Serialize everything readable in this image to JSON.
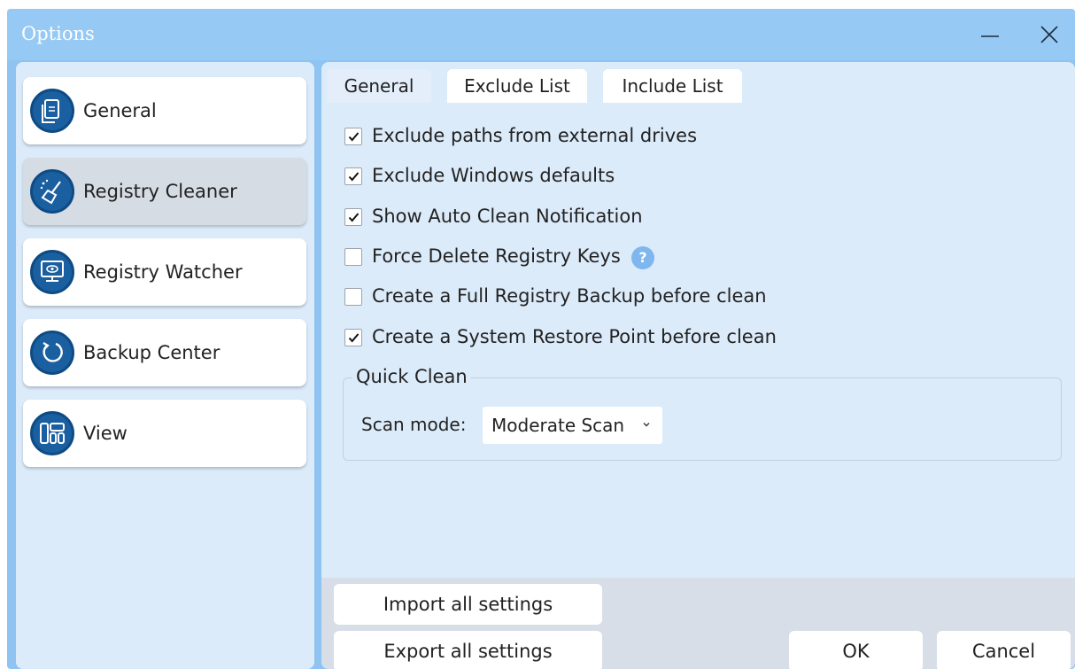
{
  "window": {
    "title": "Options"
  },
  "sidebar": {
    "items": [
      {
        "label": "General",
        "icon": "document-icon",
        "active": false
      },
      {
        "label": "Registry Cleaner",
        "icon": "broom-icon",
        "active": true
      },
      {
        "label": "Registry Watcher",
        "icon": "monitor-eye-icon",
        "active": false
      },
      {
        "label": "Backup Center",
        "icon": "restore-icon",
        "active": false
      },
      {
        "label": "View",
        "icon": "layout-icon",
        "active": false
      }
    ]
  },
  "tabs": [
    {
      "label": "General",
      "active": true
    },
    {
      "label": "Exclude List",
      "active": false
    },
    {
      "label": "Include List",
      "active": false
    }
  ],
  "options": [
    {
      "label": "Exclude paths from external drives",
      "checked": true
    },
    {
      "label": "Exclude Windows defaults",
      "checked": true
    },
    {
      "label": "Show Auto Clean Notification",
      "checked": true
    },
    {
      "label": "Force Delete Registry Keys",
      "checked": false,
      "help_icon": "question-icon",
      "help_text": "?"
    },
    {
      "label": "Create a Full Registry Backup before clean",
      "checked": false
    },
    {
      "label": "Create a System Restore Point before clean",
      "checked": true
    }
  ],
  "quick_clean": {
    "title": "Quick Clean",
    "scan_mode_label": "Scan mode:",
    "scan_mode_value": "Moderate Scan"
  },
  "footer": {
    "import_label": "Import all settings",
    "export_label": "Export all settings",
    "ok_label": "OK",
    "cancel_label": "Cancel"
  },
  "colors": {
    "titlebar": "#97c9f5",
    "panel": "#dcebfa",
    "icon_circle": "#1a5fa0",
    "accent": "#7fb6ee"
  }
}
